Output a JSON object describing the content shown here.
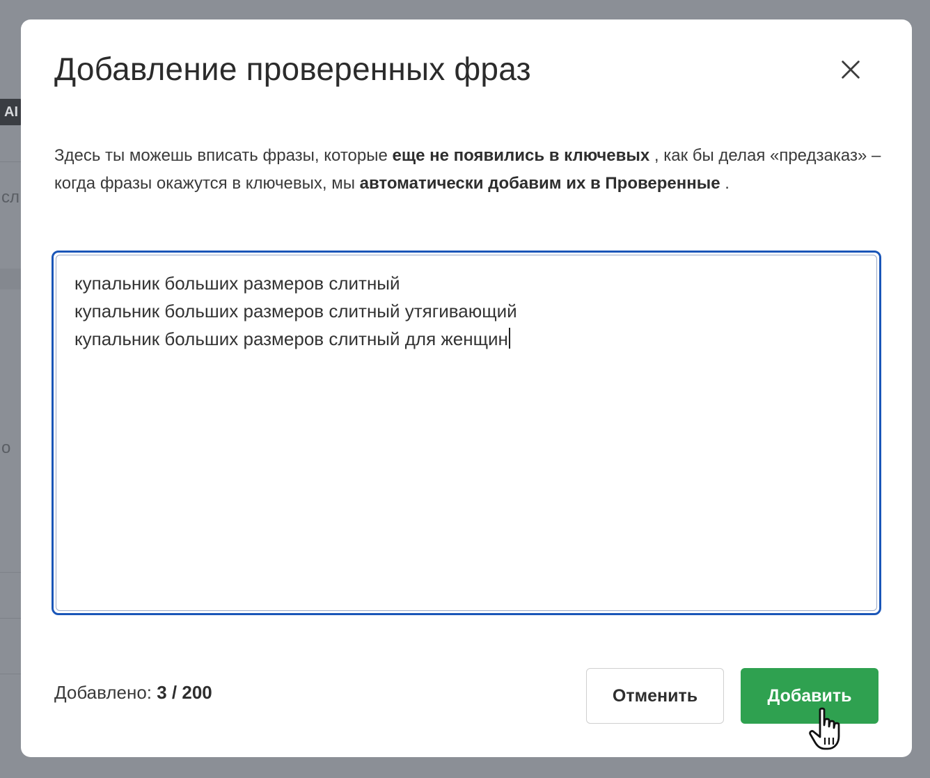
{
  "background": {
    "badge": "AI",
    "fragments": [
      "сл",
      "о"
    ]
  },
  "modal": {
    "title": "Добавление проверенных фраз",
    "close_icon": "close-icon",
    "description": {
      "part1": "Здесь ты можешь вписать фразы, которые ",
      "bold1": "еще не появились в ключевых",
      "part2": " , как бы делая «предзаказ» – когда фразы окажутся в ключевых, мы ",
      "bold2": "автоматически добавим их в Проверенные",
      "part3": " ."
    },
    "phrases": [
      "купальник больших размеров слитный",
      "купальник больших размеров слитный утягивающий",
      "купальник больших размеров слитный для женщин"
    ],
    "counter": {
      "label": "Добавлено: ",
      "value": "3 / 200"
    },
    "buttons": {
      "cancel": "Отменить",
      "add": "Добавить"
    }
  },
  "colors": {
    "accent_green": "#2fa150",
    "focus_blue": "#1a56b8",
    "overlay": "#8b8f96"
  }
}
